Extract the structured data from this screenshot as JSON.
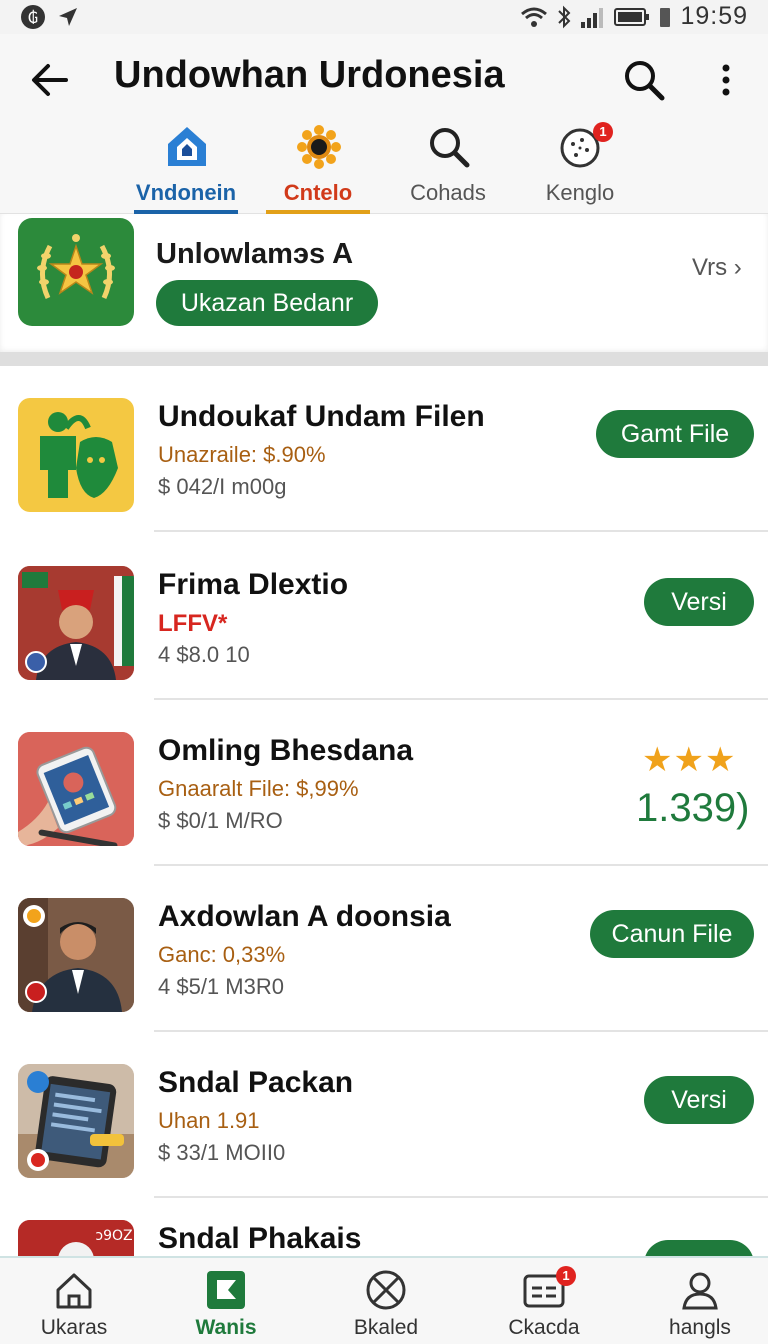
{
  "status_bar": {
    "time": "19:59"
  },
  "app_bar": {
    "title": "Undowhan Urdonesia"
  },
  "tabs": [
    {
      "label": "Vndonein",
      "icon": "home-shield-icon",
      "state": "active",
      "color": "#1b63a8"
    },
    {
      "label": "Cntelo",
      "icon": "sunflower-icon",
      "state": "active",
      "color": "#d13a1a"
    },
    {
      "label": "Cohads",
      "icon": "search-icon",
      "state": "inactive"
    },
    {
      "label": "Kenglo",
      "icon": "cookie-icon",
      "state": "inactive",
      "badge": "1"
    }
  ],
  "featured": {
    "title": "Unlowlamэs A",
    "pill_label": "Ukazan Bedanr",
    "link_label": "Vrs ›"
  },
  "list": [
    {
      "title": "Undoukaf  Undam Filen",
      "subtitle": "Unazraile: $.90%",
      "meta": "$ 042/I m00g",
      "button": "Gamt File"
    },
    {
      "title": "Frima Dlextio",
      "subtitle": "LFFV*",
      "meta": "4 $8.0 10",
      "button": "Versi"
    },
    {
      "title": "Omling Bhesdana",
      "subtitle": "Gnaaralt File: $,99%",
      "meta": "$ $0/1 M/RO",
      "rating_stars": 3,
      "rating_text": "1.339)"
    },
    {
      "title": "Axdowlan A doonsia",
      "subtitle": "Ganc: 0,33%",
      "meta": "4 $5/1 M3R0",
      "button": "Canun File"
    },
    {
      "title": "Sndal Packan",
      "subtitle": "Uhan 1.91",
      "meta": "$ 33/1 MOII0",
      "button": "Versi"
    },
    {
      "title": "Sndal Phakais",
      "subtitle": "",
      "meta": "",
      "thumb_text": "ɔ9OZ"
    }
  ],
  "bottom_nav": [
    {
      "label": "Ukaras",
      "icon": "home-icon"
    },
    {
      "label": "Wanis",
      "icon": "flag-card-icon",
      "state": "active"
    },
    {
      "label": "Bkaled",
      "icon": "globe-x-icon"
    },
    {
      "label": "Ckacda",
      "icon": "list-card-icon",
      "badge": "1"
    },
    {
      "label": "hangls",
      "icon": "person-icon"
    }
  ],
  "colors": {
    "accent": "#1f7a3c",
    "badge": "#e0231f",
    "star": "#f0a21b"
  }
}
